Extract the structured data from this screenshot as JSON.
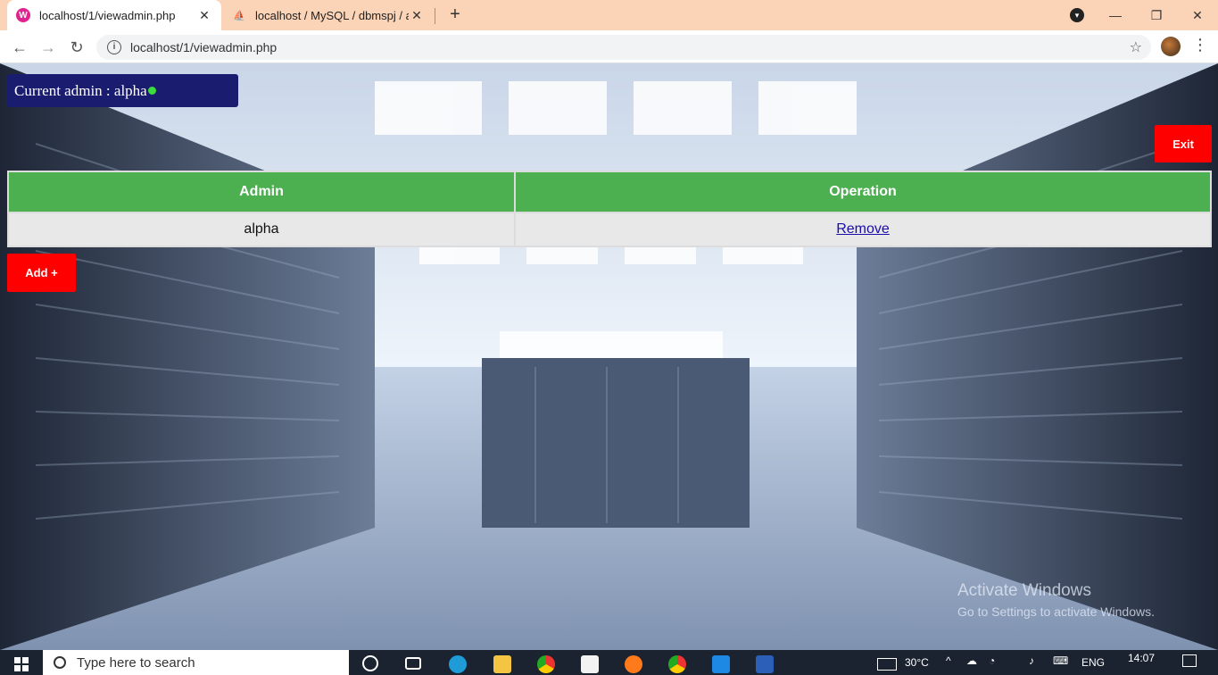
{
  "browser": {
    "tabs": [
      {
        "title": "localhost/1/viewadmin.php",
        "active": true,
        "favicon": "wamp-icon"
      },
      {
        "title": "localhost / MySQL / dbmspj / ad",
        "active": false,
        "favicon": "phpmyadmin-icon"
      }
    ],
    "url": "localhost/1/viewadmin.php",
    "window_controls": [
      "minimize",
      "restore",
      "close"
    ]
  },
  "page": {
    "current_admin_label": "Current admin : alpha",
    "exit_label": "Exit",
    "add_label": "Add +",
    "table": {
      "headers": [
        "Admin",
        "Operation"
      ],
      "rows": [
        {
          "admin": "alpha",
          "operation": "Remove"
        }
      ]
    },
    "watermark": {
      "line1": "Activate Windows",
      "line2": "Go to Settings to activate Windows."
    },
    "colors": {
      "admin_badge": "#1a1c70",
      "status_dot": "#3cdc3c",
      "danger": "#ff0000",
      "table_header": "#4caf50"
    }
  },
  "taskbar": {
    "search_placeholder": "Type here to search",
    "weather": "30°C",
    "language": "ENG",
    "time": "14:07"
  }
}
